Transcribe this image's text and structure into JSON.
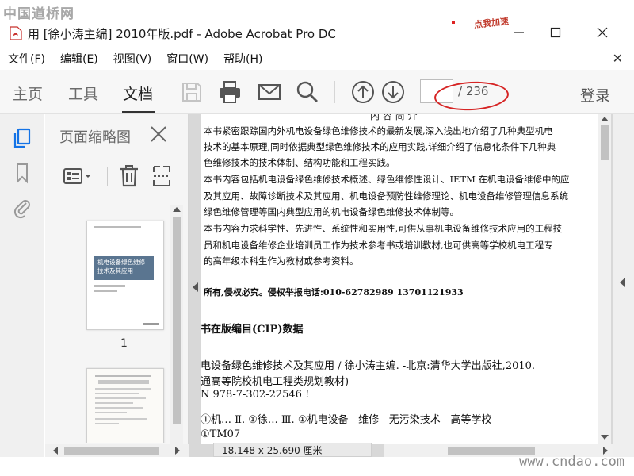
{
  "watermark_top": "中国道桥网",
  "watermark_bottom": "www.cndao.com",
  "window": {
    "title": "用 [徐小涛主编] 2010年版.pdf - Adobe Acrobat Pro DC",
    "promo": "点我加速"
  },
  "menu": {
    "items": [
      "文件(F)",
      "编辑(E)",
      "视图(V)",
      "窗口(W)",
      "帮助(H)"
    ]
  },
  "toolbar": {
    "tabs": [
      "主页",
      "工具",
      "文档"
    ],
    "active_tab": "文档",
    "page_current": "",
    "page_total": "/ 236",
    "login": "登录"
  },
  "sidebar": {
    "title": "页面缩略图",
    "thumb1_title": "机电设备绿色维修技术及其应用",
    "thumb1_number": "1"
  },
  "document": {
    "heading": "内 容 简 介",
    "lines": [
      "本书紧密跟踪国内外机电设备绿色维修技术的最新发展,深入浅出地介绍了几种典型机电",
      "技术的基本原理,同时依据典型绿色维修技术的应用实践,详细介绍了信息化条件下几种典",
      "色维修技术的技术体制、结构功能和工程实践。",
      "本书内容包括机电设备绿色维修技术概述、绿色维修性设计、IETM 在机电设备维修中的应",
      "及其应用、故障诊断技术及其应用、机电设备预防性维修理论、机电设备维修管理信息系统",
      "绿色维修管理等国内典型应用的机电设备绿色维修技术体制等。",
      "本书内容力求科学性、先进性、系统性和实用性,可供从事机电设备维修技术应用的工程技",
      "员和机电设备维修企业培训员工作为技术参考书或培训教材,也可供高等学校机电工程专",
      "的高年级本科生作为教材或参考资料。"
    ],
    "copyright": "所有,侵权必究。侵权举报电话:010-62782989   13701121933",
    "cip_title": "书在版编目(CIP)数据",
    "cip_lines": [
      "电设备绿色维修技术及其应用 / 徐小涛主编. -北京:清华大学出版社,2010.",
      "通高等院校机电工程类规划教材)",
      "N 978-7-302-22546 !",
      "①机…   Ⅱ. ①徐…   Ⅲ. ①机电设备 - 维修 - 无污染技术 - 高等学校 -",
      "①TM07"
    ],
    "dimensions": "18.148 x 25.690 厘米"
  },
  "colors": {
    "annotation_red": "#d62525",
    "toolbar_bg": "#f7f7f7",
    "rail_icon_blue": "#1473e6"
  }
}
